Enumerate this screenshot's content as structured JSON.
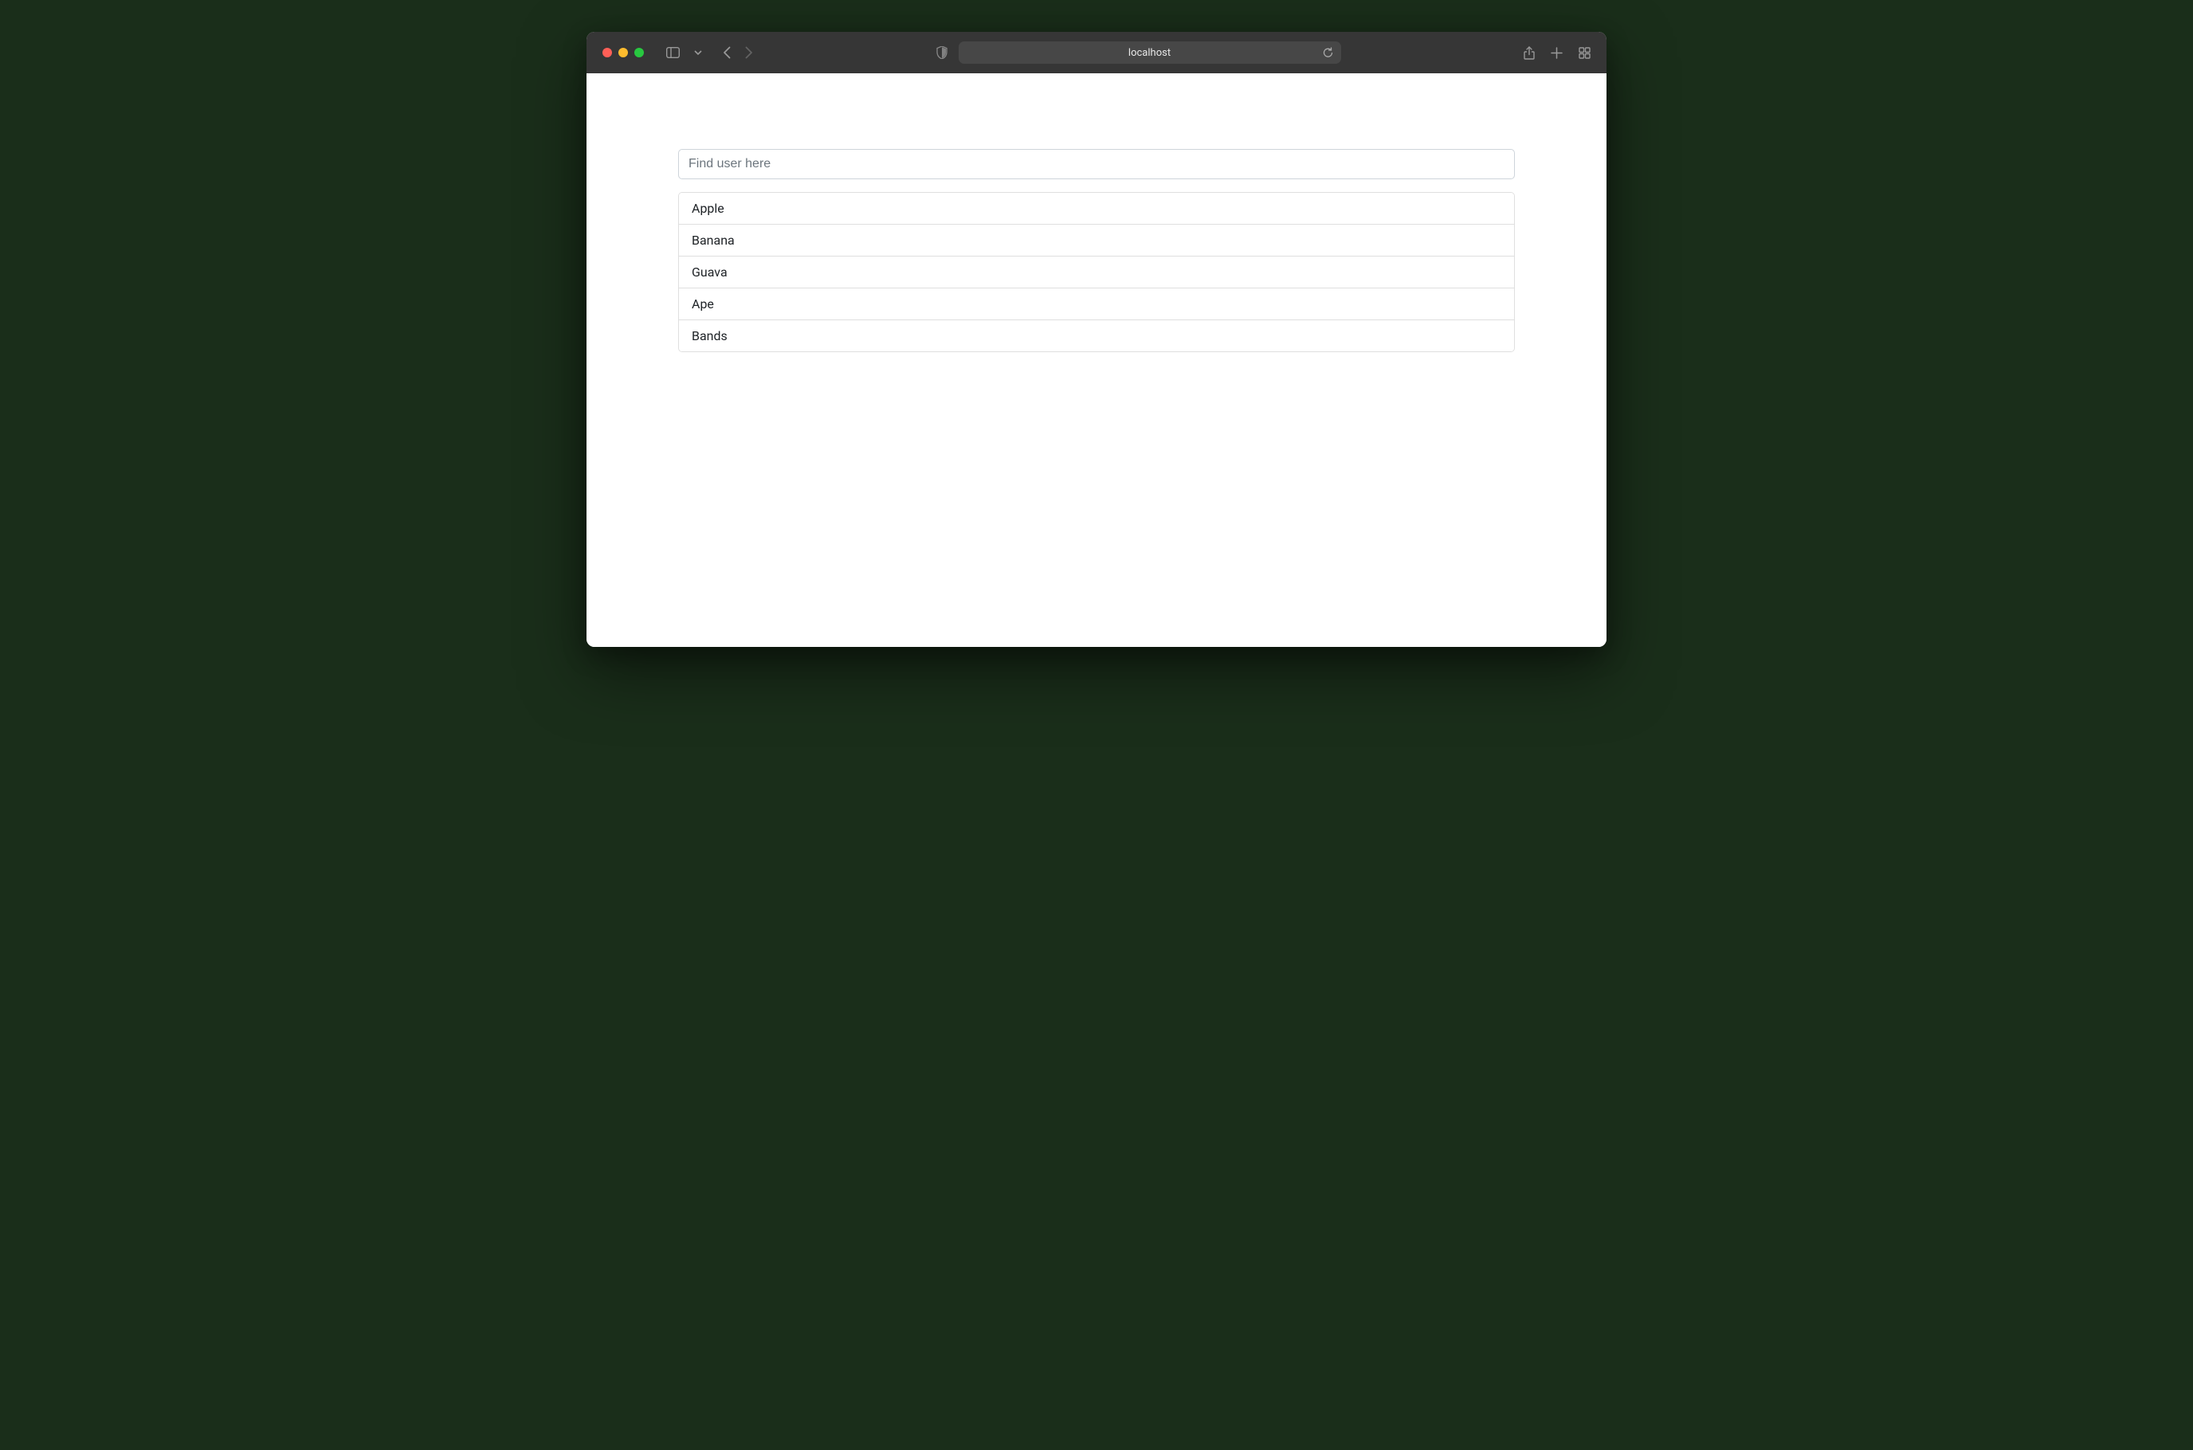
{
  "browser": {
    "address": "localhost"
  },
  "search": {
    "placeholder": "Find user here",
    "value": ""
  },
  "list": {
    "items": [
      {
        "label": "Apple"
      },
      {
        "label": "Banana"
      },
      {
        "label": "Guava"
      },
      {
        "label": "Ape"
      },
      {
        "label": "Bands"
      }
    ]
  }
}
